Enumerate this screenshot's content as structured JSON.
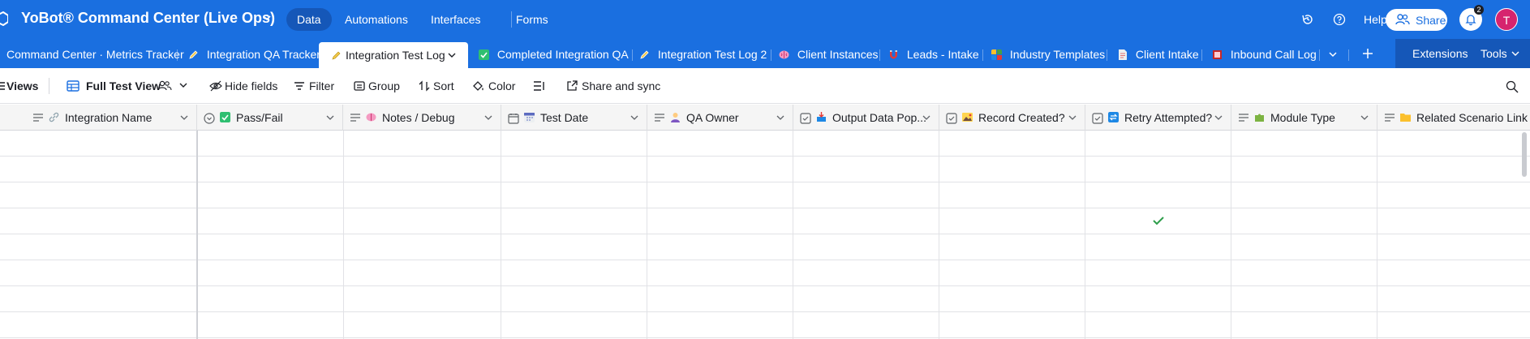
{
  "app": {
    "base_name": "YoBot® Command Center (Live Ops)",
    "nav": [
      {
        "label": "Data",
        "active": true
      },
      {
        "label": "Automations"
      },
      {
        "label": "Interfaces"
      },
      {
        "label": "Forms"
      }
    ],
    "help_label": "Help",
    "share_label": "Share",
    "notification_count": "2",
    "avatar_initial": "T",
    "accent_color": "#1a6fe0",
    "avatar_color": "#d6246e"
  },
  "tables": {
    "tabs": [
      {
        "label": "Command Center · Metrics Tracker",
        "icon": "none"
      },
      {
        "label": "Integration QA Tracker",
        "icon": "pencil-icon"
      },
      {
        "label": "Integration Test Log",
        "icon": "pencil-icon",
        "active": true
      },
      {
        "label": "Completed Integration QA",
        "icon": "check-box-icon"
      },
      {
        "label": "Integration Test Log 2",
        "icon": "pencil-icon"
      },
      {
        "label": "Client Instances",
        "icon": "brain-icon"
      },
      {
        "label": "Leads - Intake",
        "icon": "magnet-icon"
      },
      {
        "label": "Industry Templates",
        "icon": "blocks-icon"
      },
      {
        "label": "Client Intake",
        "icon": "document-icon"
      },
      {
        "label": "Inbound Call Log",
        "icon": "ledger-icon"
      }
    ],
    "extensions_label": "Extensions",
    "tools_label": "Tools"
  },
  "toolbar": {
    "views_label": "Views",
    "view_name": "Full Test View",
    "hide_fields": "Hide fields",
    "filter": "Filter",
    "group": "Group",
    "sort": "Sort",
    "color": "Color",
    "share_sync": "Share and sync"
  },
  "grid": {
    "columns": [
      {
        "name": "Integration Name",
        "type": "long-text",
        "icon": "link-icon"
      },
      {
        "name": "Pass/Fail",
        "type": "single-select",
        "icon": "check-box-icon"
      },
      {
        "name": "Notes / Debug",
        "type": "long-text",
        "icon": "brain-icon"
      },
      {
        "name": "Test Date",
        "type": "date",
        "icon": "calendar-icon"
      },
      {
        "name": "QA Owner",
        "type": "long-text",
        "icon": "person-icon"
      },
      {
        "name": "Output Data Pop...",
        "type": "checkbox",
        "icon": "inbox-icon"
      },
      {
        "name": "Record Created?",
        "type": "checkbox",
        "icon": "picture-icon"
      },
      {
        "name": "Retry Attempted?",
        "type": "checkbox",
        "icon": "retry-icon"
      },
      {
        "name": "Module Type",
        "type": "long-text",
        "icon": "puzzle-icon"
      },
      {
        "name": "Related Scenario Link",
        "type": "long-text",
        "icon": "folder-icon"
      }
    ],
    "rows": [
      {
        "retry_attempted": false
      },
      {
        "retry_attempted": false
      },
      {
        "retry_attempted": false
      },
      {
        "retry_attempted": true
      },
      {
        "retry_attempted": false
      },
      {
        "retry_attempted": false
      },
      {
        "retry_attempted": false
      },
      {
        "retry_attempted": false
      }
    ]
  }
}
